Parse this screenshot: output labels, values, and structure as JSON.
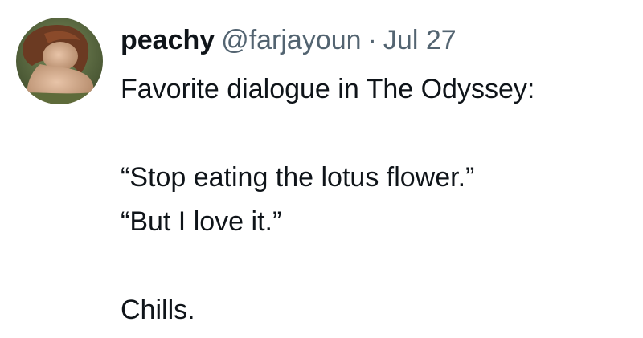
{
  "tweet": {
    "author": {
      "display_name": "peachy",
      "handle": "@farjayoun",
      "avatar_icon": "avatar-painting-icon"
    },
    "separator": "·",
    "date": "Jul 27",
    "lines": [
      "Favorite dialogue in The Odyssey:",
      "",
      "“Stop eating the lotus flower.”",
      "“But I love it.”",
      "",
      "Chills."
    ]
  },
  "colors": {
    "text_primary": "#0f1419",
    "text_secondary": "#536471",
    "background": "#ffffff"
  }
}
